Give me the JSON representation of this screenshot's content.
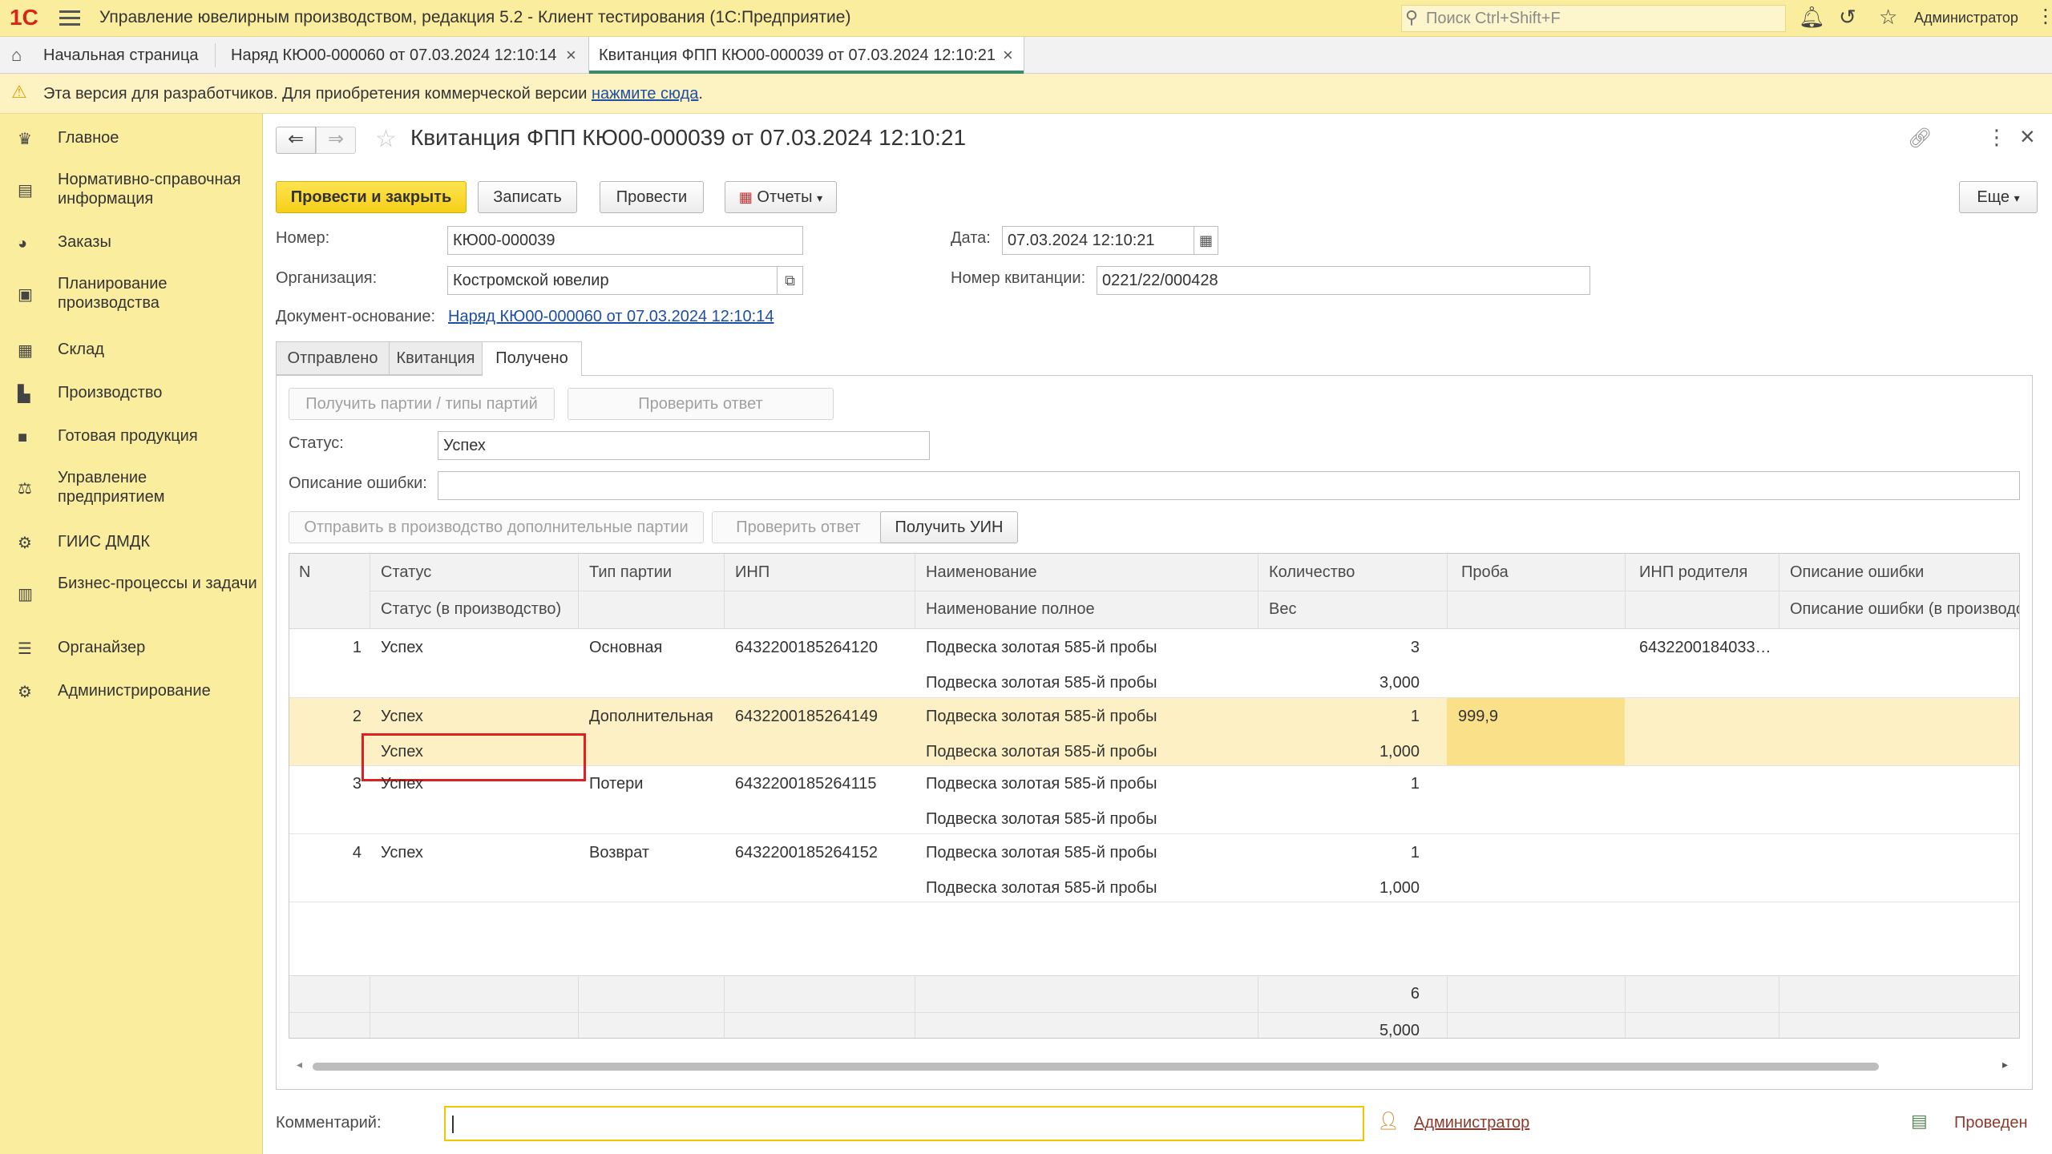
{
  "app": {
    "logo": "1С",
    "title": "Управление ювелирным производством, редакция 5.2  - Клиент тестирования (1С:Предприятие)",
    "search_placeholder": "Поиск Ctrl+Shift+F",
    "user": "Администратор"
  },
  "tabs": [
    {
      "label": "Начальная страница"
    },
    {
      "label": "Наряд КЮ00-000060 от 07.03.2024 12:10:14"
    },
    {
      "label": "Квитанция ФПП КЮ00-000039 от 07.03.2024 12:10:21"
    }
  ],
  "warning": {
    "text": "Эта версия для разработчиков. Для приобретения коммерческой версии ",
    "link": "нажмите сюда",
    "tail": "."
  },
  "sidebar": {
    "items": [
      {
        "label": "Главное",
        "icon": "crown-icon"
      },
      {
        "label": "Нормативно-справочная информация",
        "icon": "books-icon"
      },
      {
        "label": "Заказы",
        "icon": "pie-icon"
      },
      {
        "label": "Планирование производства",
        "icon": "clipboard-icon"
      },
      {
        "label": "Склад",
        "icon": "grid-icon"
      },
      {
        "label": "Производство",
        "icon": "factory-icon"
      },
      {
        "label": "Готовая продукция",
        "icon": "bag-icon"
      },
      {
        "label": "Управление предприятием",
        "icon": "org-icon"
      },
      {
        "label": "ГИИС ДМДК",
        "icon": "gear-icon"
      },
      {
        "label": "Бизнес-процессы и задачи",
        "icon": "tasks-icon"
      },
      {
        "label": "Органайзер",
        "icon": "organizer-icon"
      },
      {
        "label": "Администрирование",
        "icon": "settings-icon"
      }
    ]
  },
  "form": {
    "title": "Квитанция ФПП КЮ00-000039 от 07.03.2024 12:10:21",
    "buttons": {
      "post_close": "Провести и закрыть",
      "save": "Записать",
      "post": "Провести",
      "reports": "Отчеты",
      "more": "Еще"
    },
    "number_label": "Номер:",
    "number_value": "КЮ00-000039",
    "date_label": "Дата:",
    "date_value": "07.03.2024 12:10:21",
    "org_label": "Организация:",
    "org_value": "Костромской ювелир",
    "receipt_label": "Номер квитанции:",
    "receipt_value": "0221/22/000428",
    "basis_label": "Документ-основание:",
    "basis_value": "Наряд КЮ00-000060 от 07.03.2024 12:10:14",
    "subtabs": [
      "Отправлено",
      "Квитанция",
      "Получено"
    ],
    "received": {
      "get_batches": "Получить партии / типы партий",
      "check_answer": "Проверить ответ",
      "status_label": "Статус:",
      "status_value": "Успех",
      "error_label": "Описание ошибки:",
      "error_value": "",
      "send_extra": "Отправить в производство дополнительные партии",
      "check_answer2": "Проверить ответ",
      "get_uin": "Получить УИН"
    },
    "table": {
      "headers1": [
        "N",
        "Статус",
        "Тип партии",
        "ИНП",
        "Наименование",
        "Количество",
        "Проба",
        "ИНП родителя",
        "Описание ошибки"
      ],
      "headers2": [
        "",
        "Статус (в производство)",
        "",
        "",
        "Наименование полное",
        "Вес",
        "",
        "",
        "Описание ошибки (в производство)"
      ],
      "rows": [
        {
          "n": "1",
          "status": "Успех",
          "status2": "",
          "type": "Основная",
          "inp": "6432200185264120",
          "name": "Подвеска золотая 585-й пробы",
          "name2": "Подвеска золотая 585-й пробы",
          "qty": "3",
          "weight": "3,000",
          "probe": "",
          "parent": "6432200184033…",
          "err": ""
        },
        {
          "n": "2",
          "status": "Успех",
          "status2": "Успех",
          "type": "Дополнительная",
          "inp": "6432200185264149",
          "name": "Подвеска золотая 585-й пробы",
          "name2": "Подвеска золотая 585-й пробы",
          "qty": "1",
          "weight": "1,000",
          "probe": "999,9",
          "parent": "",
          "err": ""
        },
        {
          "n": "3",
          "status": "Успех",
          "status2": "",
          "type": "Потери",
          "inp": "6432200185264115",
          "name": "Подвеска золотая 585-й пробы",
          "name2": "Подвеска золотая 585-й пробы",
          "qty": "1",
          "weight": "",
          "probe": "",
          "parent": "",
          "err": ""
        },
        {
          "n": "4",
          "status": "Успех",
          "status2": "",
          "type": "Возврат",
          "inp": "6432200185264152",
          "name": "Подвеска золотая 585-й пробы",
          "name2": "Подвеска золотая 585-й пробы",
          "qty": "1",
          "weight": "1,000",
          "probe": "",
          "parent": "",
          "err": ""
        }
      ],
      "total_qty": "6",
      "total_weight": "5,000"
    },
    "comment_label": "Комментарий:",
    "comment_value": "",
    "author": "Администратор",
    "state": "Проведен"
  }
}
